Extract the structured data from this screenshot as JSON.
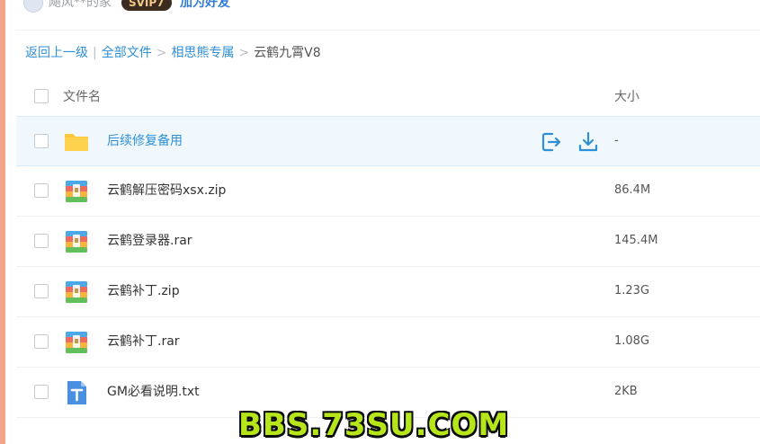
{
  "header": {
    "username": "飓风**的家",
    "badge": "SVIP7",
    "add_friend": "加为好友"
  },
  "breadcrumb": {
    "back": "返回上一级",
    "separator_bar": "|",
    "items": [
      "全部文件",
      "相思熊专属"
    ],
    "current": "云鹤九霄V8",
    "arrow": ">"
  },
  "columns": {
    "name": "文件名",
    "size": "大小"
  },
  "files": [
    {
      "name": "后续修复备用",
      "size": "-",
      "type": "folder-icon"
    },
    {
      "name": "云鹤解压密码xsx.zip",
      "size": "86.4M",
      "type": "archive-icon"
    },
    {
      "name": "云鹤登录器.rar",
      "size": "145.4M",
      "type": "archive-icon"
    },
    {
      "name": "云鹤补丁.zip",
      "size": "1.23G",
      "type": "archive-icon"
    },
    {
      "name": "云鹤补丁.rar",
      "size": "1.08G",
      "type": "archive-icon"
    },
    {
      "name": "GM必看说明.txt",
      "size": "2KB",
      "type": "text-file-icon"
    }
  ],
  "watermark": "BBS.73SU.COM",
  "colors": {
    "accent": "#2f8fd6",
    "hover_row": "#f0f8fe",
    "folder": "#ffc63a",
    "watermark": "#b6e61a"
  }
}
